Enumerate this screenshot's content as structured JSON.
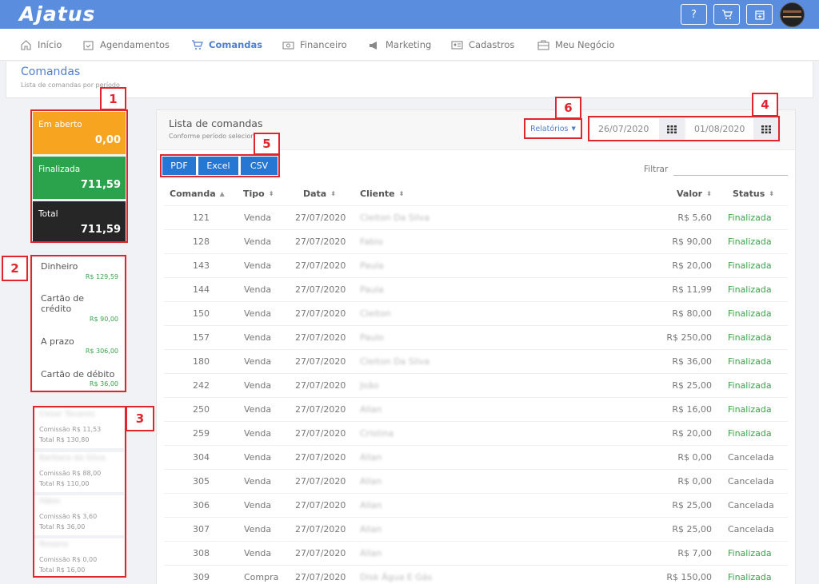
{
  "app": {
    "logo": "Ajatus"
  },
  "topbar": {
    "help_label": "?",
    "cart_icon": "cart-icon",
    "calendar_icon": "calendar-plus-icon"
  },
  "nav": {
    "items": [
      {
        "label": "Início",
        "icon": "home-icon"
      },
      {
        "label": "Agendamentos",
        "icon": "calendar-check-icon"
      },
      {
        "label": "Comandas",
        "icon": "cart-icon",
        "active": true
      },
      {
        "label": "Financeiro",
        "icon": "money-icon"
      },
      {
        "label": "Marketing",
        "icon": "megaphone-icon"
      },
      {
        "label": "Cadastros",
        "icon": "id-card-icon"
      },
      {
        "label": "Meu Negócio",
        "icon": "briefcase-icon"
      }
    ]
  },
  "page": {
    "title": "Comandas",
    "subtitle": "Lista de comandas por período"
  },
  "annotations": [
    "1",
    "2",
    "3",
    "4",
    "5",
    "6"
  ],
  "status_cards": [
    {
      "label": "Em aberto",
      "value": "0,00",
      "color": "#f7a521"
    },
    {
      "label": "Finalizada",
      "value": "711,59",
      "color": "#2ba24c"
    },
    {
      "label": "Total",
      "value": "711,59",
      "color": "#262626"
    }
  ],
  "payments": [
    {
      "label": "Dinheiro",
      "value": "R$ 129,59"
    },
    {
      "label": "Cartão de crédito",
      "value": "R$ 90,00"
    },
    {
      "label": "A prazo",
      "value": "R$ 306,00"
    },
    {
      "label": "Cartão de débito",
      "value": "R$ 36,00"
    }
  ],
  "employees": [
    {
      "name": "Cesar Tavares",
      "commission": "Comissão R$ 11,53",
      "total": "Total R$ 130,80"
    },
    {
      "name": "Barbara da Silva",
      "commission": "Comissão R$ 88,00",
      "total": "Total R$ 110,00"
    },
    {
      "name": "Fábio",
      "commission": "Comissão R$ 3,60",
      "total": "Total R$ 36,00"
    },
    {
      "name": "Rosana",
      "commission": "Comissão R$ 0,00",
      "total": "Total R$ 16,00"
    }
  ],
  "panel": {
    "title": "Lista de comandas",
    "subtitle": "Conforme período selecionado"
  },
  "toolbar": {
    "reports_label": "Relatórios",
    "date_from": "26/07/2020",
    "date_to": "01/08/2020",
    "pdf_label": "PDF",
    "excel_label": "Excel",
    "csv_label": "CSV",
    "filter_label": "Filtrar"
  },
  "table": {
    "headers": [
      "Comanda",
      "Tipo",
      "Data",
      "Cliente",
      "Valor",
      "Status"
    ],
    "rows": [
      {
        "id": "121",
        "type": "Venda",
        "date": "27/07/2020",
        "client": "Cleiton Da Silva",
        "value": "R$ 5,60",
        "status": "Finalizada"
      },
      {
        "id": "128",
        "type": "Venda",
        "date": "27/07/2020",
        "client": "Fabio",
        "value": "R$ 90,00",
        "status": "Finalizada"
      },
      {
        "id": "143",
        "type": "Venda",
        "date": "27/07/2020",
        "client": "Paula",
        "value": "R$ 20,00",
        "status": "Finalizada"
      },
      {
        "id": "144",
        "type": "Venda",
        "date": "27/07/2020",
        "client": "Paula",
        "value": "R$ 11,99",
        "status": "Finalizada"
      },
      {
        "id": "150",
        "type": "Venda",
        "date": "27/07/2020",
        "client": "Cleiton",
        "value": "R$ 80,00",
        "status": "Finalizada"
      },
      {
        "id": "157",
        "type": "Venda",
        "date": "27/07/2020",
        "client": "Paulo",
        "value": "R$ 250,00",
        "status": "Finalizada"
      },
      {
        "id": "180",
        "type": "Venda",
        "date": "27/07/2020",
        "client": "Cleiton Da Silva",
        "value": "R$ 36,00",
        "status": "Finalizada"
      },
      {
        "id": "242",
        "type": "Venda",
        "date": "27/07/2020",
        "client": "João",
        "value": "R$ 25,00",
        "status": "Finalizada"
      },
      {
        "id": "250",
        "type": "Venda",
        "date": "27/07/2020",
        "client": "Allan",
        "value": "R$ 16,00",
        "status": "Finalizada"
      },
      {
        "id": "259",
        "type": "Venda",
        "date": "27/07/2020",
        "client": "Cristina",
        "value": "R$ 20,00",
        "status": "Finalizada"
      },
      {
        "id": "304",
        "type": "Venda",
        "date": "27/07/2020",
        "client": "Allan",
        "value": "R$ 0,00",
        "status": "Cancelada"
      },
      {
        "id": "305",
        "type": "Venda",
        "date": "27/07/2020",
        "client": "Allan",
        "value": "R$ 0,00",
        "status": "Cancelada"
      },
      {
        "id": "306",
        "type": "Venda",
        "date": "27/07/2020",
        "client": "Allan",
        "value": "R$ 25,00",
        "status": "Cancelada"
      },
      {
        "id": "307",
        "type": "Venda",
        "date": "27/07/2020",
        "client": "Allan",
        "value": "R$ 25,00",
        "status": "Cancelada"
      },
      {
        "id": "308",
        "type": "Venda",
        "date": "27/07/2020",
        "client": "Allan",
        "value": "R$ 7,00",
        "status": "Finalizada"
      },
      {
        "id": "309",
        "type": "Compra",
        "date": "27/07/2020",
        "client": "Disk Água E Gás",
        "value": "R$ 150,00",
        "status": "Finalizada"
      }
    ]
  }
}
